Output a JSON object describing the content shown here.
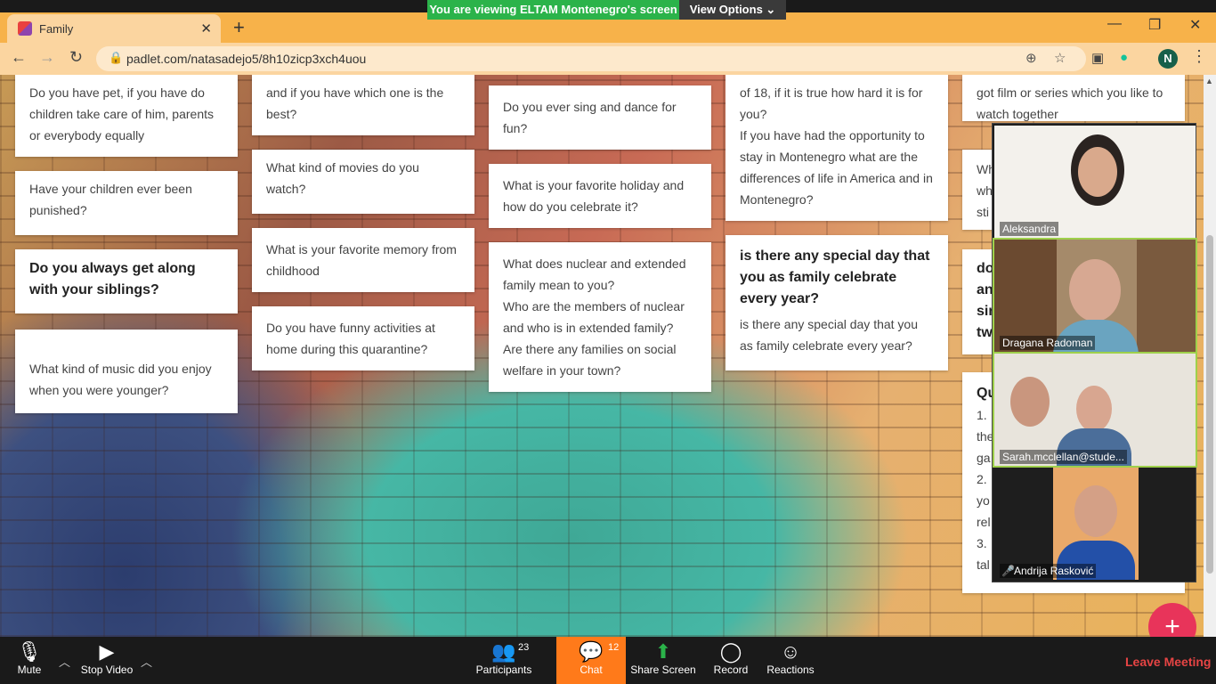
{
  "share_banner": {
    "text": "You are viewing ELTAM Montenegro's screen",
    "view_options": "View Options ⌄",
    "color": "#2bb34a"
  },
  "browser": {
    "tab_title": "Family",
    "tab_close": "✕",
    "new_tab": "+",
    "url": "padlet.com/natasadejo5/8h10zicp3xch4uou",
    "profile_initial": "N",
    "window_controls": [
      "—",
      "❐",
      "✕"
    ]
  },
  "padlet": {
    "col1": [
      "Do you have pet, if you have do children take care of him, parents or everybody equally",
      "Have your children ever been punished?",
      "Do you always get along with your siblings?",
      "What kind of music did you enjoy when you were younger?"
    ],
    "col2": [
      "and if you have which one is the best?",
      "What kind of movies do you watch?",
      "What is your favorite memory from childhood",
      "Do you have funny activities at home during this quarantine?"
    ],
    "col3": [
      "Do you ever sing and dance for fun?",
      "What is your favorite holiday and how do you celebrate it?",
      "What does nuclear and extended family mean to you?",
      "Who are the members of nuclear and who is in extended family?",
      "Are there any families on social welfare in your town?"
    ],
    "col4": [
      "of 18, if it is true how hard it is for you?",
      "If you have had the opportunity to stay in Montenegro what are the differences of life in America and in Montenegro?",
      "is there any special day that you as family celebrate every year?",
      "is there any special day that you as family celebrate every year?"
    ],
    "col5": [
      "got film or series which you like to watch together",
      "Wh",
      "wh",
      "sti",
      "do",
      "an",
      "sir",
      "tw",
      "Qu",
      "1.",
      "the",
      "ga",
      "2.",
      "yo",
      "rel",
      "3.",
      "tal"
    ],
    "fab_label": "+"
  },
  "participants_video": [
    {
      "name": "Aleksandra"
    },
    {
      "name": "Dragana Radoman"
    },
    {
      "name": "Sarah.mcclellan@stude..."
    },
    {
      "name": "Andrija Rasković"
    }
  ],
  "toolbar": {
    "mute": "Mute",
    "stop_video": "Stop Video",
    "participants": "Participants",
    "participants_count": "23",
    "chat": "Chat",
    "chat_count": "12",
    "share_screen": "Share Screen",
    "record": "Record",
    "reactions": "Reactions",
    "leave": "Leave Meeting",
    "accent_color": "#ff7a1a",
    "leave_color": "#e64444"
  }
}
